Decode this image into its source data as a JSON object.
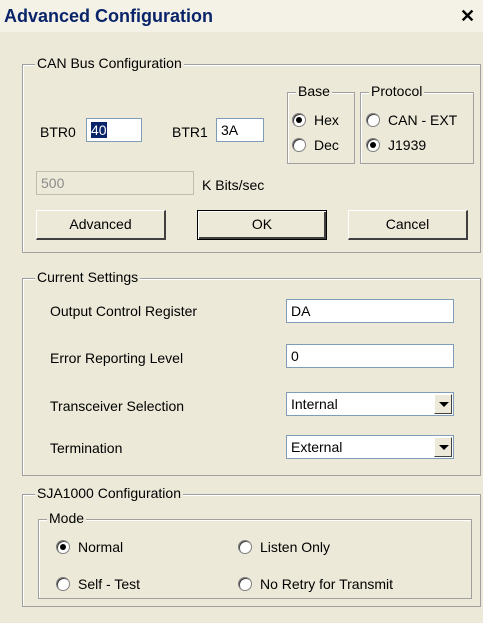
{
  "window": {
    "title": "Advanced Configuration",
    "close_glyph": "✕"
  },
  "can_bus": {
    "legend": "CAN Bus Configuration",
    "btr0_label": "BTR0",
    "btr0_value": "40",
    "btr1_label": "BTR1",
    "btr1_value": "3A",
    "base": {
      "legend": "Base",
      "options": [
        "Hex",
        "Dec"
      ],
      "selected": "Hex"
    },
    "protocol": {
      "legend": "Protocol",
      "options": [
        "CAN - EXT",
        "J1939"
      ],
      "selected": "J1939"
    },
    "bitrate_value": "500",
    "bitrate_unit": "K Bits/sec",
    "buttons": {
      "advanced": "Advanced",
      "ok": "OK",
      "cancel": "Cancel"
    }
  },
  "current_settings": {
    "legend": "Current Settings",
    "output_control_label": "Output Control Register",
    "output_control_value": "DA",
    "error_reporting_label": "Error Reporting Level",
    "error_reporting_value": "0",
    "transceiver_label": "Transceiver Selection",
    "transceiver_value": "Internal",
    "termination_label": "Termination",
    "termination_value": "External"
  },
  "sja1000": {
    "legend": "SJA1000 Configuration",
    "mode_legend": "Mode",
    "modes": [
      "Normal",
      "Listen Only",
      "Self - Test",
      "No Retry for Transmit"
    ],
    "selected_mode": "Normal"
  },
  "icons": {
    "close": "close-icon",
    "dropdown": "chevron-down-icon",
    "radio": "radio-icon"
  }
}
